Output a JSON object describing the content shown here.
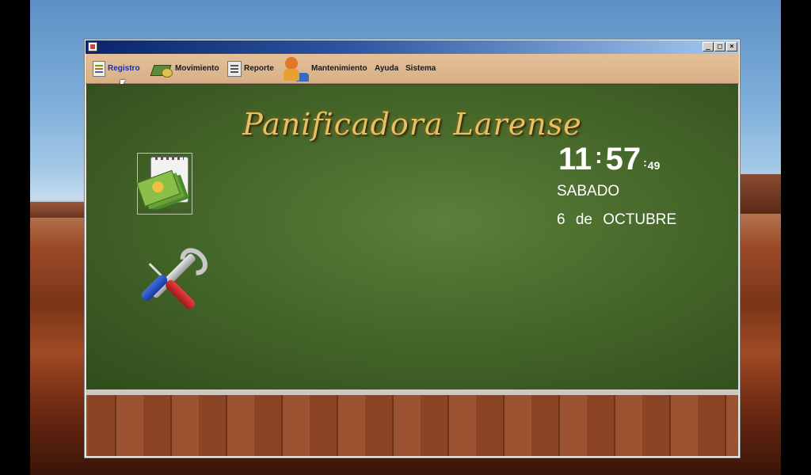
{
  "window": {
    "title": "",
    "controls": {
      "minimize": "_",
      "maximize": "□",
      "close": "×"
    }
  },
  "menu": {
    "items": [
      {
        "label": "Registro",
        "icon": "registro-icon",
        "active": true
      },
      {
        "label": "Movimiento",
        "icon": "movimiento-icon"
      },
      {
        "label": "Reporte",
        "icon": "reporte-icon"
      },
      {
        "label": "Mantenimiento",
        "icon": "mantenimiento-icon"
      },
      {
        "label": "Ayuda"
      },
      {
        "label": "Sistema"
      }
    ]
  },
  "app": {
    "title": "Panificadora Larense"
  },
  "clock": {
    "hours": "11",
    "minutes": "57",
    "seconds": "49",
    "day": "SABADO",
    "date": "6 de  OCTUBRE"
  },
  "shortcuts": [
    {
      "icon": "money-notepad-icon"
    },
    {
      "icon": "tools-icon"
    }
  ],
  "colors": {
    "title_gold": "#e8c060",
    "active_menu": "#1b2fa8",
    "board_green": "#46682a"
  }
}
